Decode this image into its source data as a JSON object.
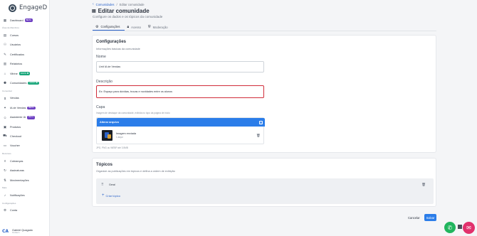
{
  "app": {
    "logo": "EngageD"
  },
  "sidebar": {
    "items": [
      {
        "label": "Dashboard",
        "icon": "grid-icon",
        "badge": "BETA",
        "badge_color": "#6d3fc2"
      },
      {
        "section": "Área de Membros"
      },
      {
        "label": "Cursos",
        "icon": "book-icon"
      },
      {
        "label": "Usuários",
        "icon": "users-icon"
      },
      {
        "label": "Certificados",
        "icon": "certificate-icon"
      },
      {
        "label": "Relatórios",
        "icon": "report-icon"
      },
      {
        "label": "Vitrine",
        "icon": "storefront-icon",
        "badge": "NOVO ✱",
        "badge_color": "#19a67a"
      },
      {
        "label": "Comunidades",
        "icon": "community-icon",
        "badge": "NOVO ✱",
        "badge_color": "#19a67a"
      },
      {
        "section": "Comercial"
      },
      {
        "label": "Vendas",
        "icon": "sales-icon"
      },
      {
        "label": "IA de Vendas",
        "icon": "ai-icon",
        "badge": "BETA",
        "badge_color": "#6d3fc2"
      },
      {
        "label": "Assistente IA",
        "icon": "assistant-icon",
        "badge": "BETA",
        "badge_color": "#6d3fc2"
      },
      {
        "label": "Produtos",
        "icon": "box-icon"
      },
      {
        "label": "Checkout",
        "icon": "cart-icon"
      },
      {
        "label": "Voucher",
        "icon": "ticket-icon"
      },
      {
        "section": "Recursos"
      },
      {
        "label": "Cobranças",
        "icon": "billing-icon"
      },
      {
        "label": "Assinaturas",
        "icon": "subscription-icon"
      },
      {
        "label": "Movimentações",
        "icon": "movements-icon"
      },
      {
        "section": "Mais"
      },
      {
        "label": "Notificações",
        "icon": "bell-icon"
      },
      {
        "section": "Configurações"
      },
      {
        "label": "Conta",
        "icon": "settings-icon"
      }
    ],
    "user": {
      "name": "Gabriel Quagado",
      "sub": "Conta 1",
      "avatar": "CA"
    }
  },
  "breadcrumb": {
    "back": "‹",
    "parent": "Comunidades",
    "separator": "/",
    "current": "Editar comunidade"
  },
  "header": {
    "title": "Editar comunidade",
    "subtitle": "Configure os dados e os tópicos da comunidade"
  },
  "tabs": [
    {
      "label": "Configurações",
      "icon": "gear-icon",
      "active": true
    },
    {
      "label": "Acesso",
      "icon": "lock-icon",
      "active": false
    },
    {
      "label": "Moderação",
      "icon": "shield-icon",
      "active": false
    }
  ],
  "config": {
    "title": "Configurações",
    "subtitle": "Informações básicas da comunidade",
    "name_label": "Nome",
    "name_value": "Unit IA de Vendas",
    "description_label": "Descrição",
    "description_value": "Ex: Espaço para dúvidas, trocas e novidades entre os alunos",
    "cover_label": "Capa",
    "cover_help": "Imagem de destaque da comunidade, exibida no topo da página de início",
    "upload_header": "Alterar arquivo",
    "file_name": "Imagem enviada",
    "file_size": "1 arqui",
    "file_hint": "JPG, PNG ou WEBP até 3.5MB"
  },
  "topics": {
    "title": "Tópicos",
    "subtitle": "Organize as publicações em tópicos e defina a ordem de exibição",
    "items": [
      {
        "name": "Geral"
      }
    ],
    "add_label": "Criar tópico"
  },
  "actions": {
    "cancel": "Cancelar",
    "save": "Salvar"
  },
  "colors": {
    "accent": "#2b7de9",
    "error": "#d12d3a",
    "whatsapp": "#21b55e",
    "chat": "#e1306c"
  }
}
